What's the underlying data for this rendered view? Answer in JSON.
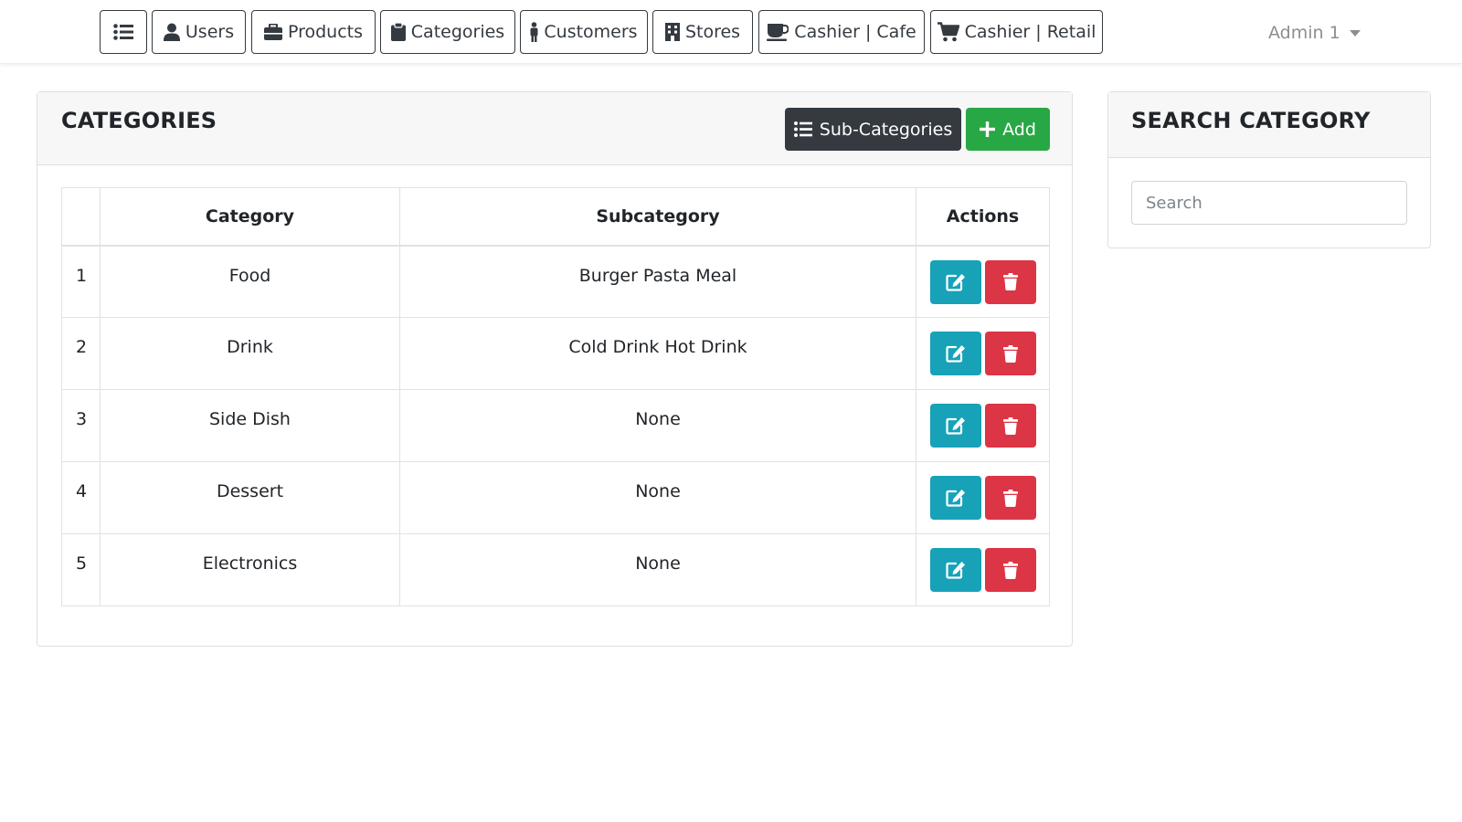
{
  "navbar": {
    "items": [
      {
        "label": "",
        "icon": "list-icon"
      },
      {
        "label": "Users",
        "icon": "user-icon"
      },
      {
        "label": "Products",
        "icon": "briefcase-icon"
      },
      {
        "label": "Categories",
        "icon": "clipboard-icon"
      },
      {
        "label": "Customers",
        "icon": "person-icon"
      },
      {
        "label": "Stores",
        "icon": "building-icon"
      },
      {
        "label": "Cashier | Cafe",
        "icon": "coffee-icon"
      },
      {
        "label": "Cashier | Retail",
        "icon": "cart-icon"
      }
    ],
    "user_menu": "Admin 1"
  },
  "categories_card": {
    "title": "CATEGORIES",
    "subcategories_button": "Sub-Categories",
    "add_button": "Add",
    "table": {
      "headers": [
        "",
        "Category",
        "Subcategory",
        "Actions"
      ],
      "rows": [
        {
          "num": "1",
          "category": "Food",
          "subcategory": "Burger Pasta Meal"
        },
        {
          "num": "2",
          "category": "Drink",
          "subcategory": "Cold Drink Hot Drink"
        },
        {
          "num": "3",
          "category": "Side Dish",
          "subcategory": "None"
        },
        {
          "num": "4",
          "category": "Dessert",
          "subcategory": "None"
        },
        {
          "num": "5",
          "category": "Electronics",
          "subcategory": "None"
        }
      ]
    }
  },
  "search_card": {
    "title": "SEARCH CATEGORY",
    "placeholder": "Search",
    "value": ""
  },
  "colors": {
    "dark": "#343a40",
    "success": "#28a745",
    "info": "#17a2b8",
    "danger": "#dc3545",
    "header_bg": "#f7f7f7"
  }
}
